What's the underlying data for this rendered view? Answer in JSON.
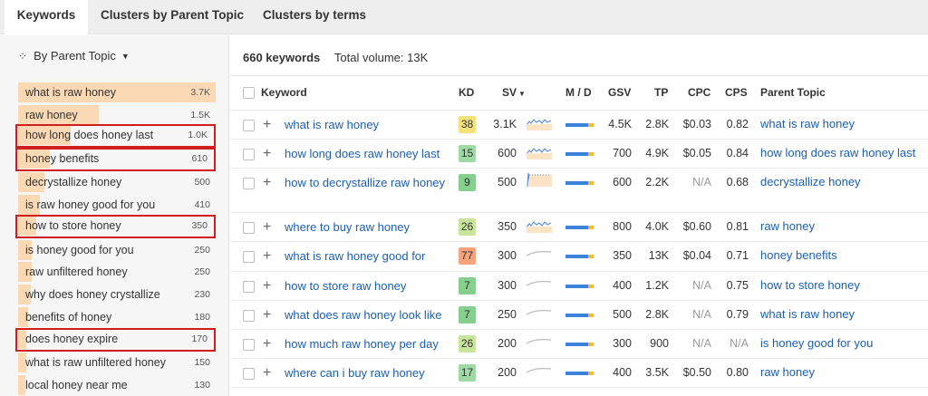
{
  "tabs": [
    "Keywords",
    "Clusters by Parent Topic",
    "Clusters by terms"
  ],
  "sidebar": {
    "group_by": "By Parent Topic",
    "clusters": [
      {
        "name": "what is raw honey",
        "volume": "3.7K",
        "share": 1.0,
        "highlighted": false
      },
      {
        "name": "raw honey",
        "volume": "1.5K",
        "share": 0.41,
        "highlighted": false
      },
      {
        "name": "how long does honey last",
        "volume": "1.0K",
        "share": 0.27,
        "highlighted": true
      },
      {
        "name": "honey benefits",
        "volume": "610",
        "share": 0.165,
        "highlighted": true
      },
      {
        "name": "decrystallize honey",
        "volume": "500",
        "share": 0.135,
        "highlighted": false
      },
      {
        "name": "is raw honey good for you",
        "volume": "410",
        "share": 0.11,
        "highlighted": false
      },
      {
        "name": "how to store honey",
        "volume": "350",
        "share": 0.095,
        "highlighted": true
      },
      {
        "name": "is honey good for you",
        "volume": "250",
        "share": 0.068,
        "highlighted": false
      },
      {
        "name": "raw unfiltered honey",
        "volume": "250",
        "share": 0.068,
        "highlighted": false
      },
      {
        "name": "why does honey crystallize",
        "volume": "230",
        "share": 0.062,
        "highlighted": false
      },
      {
        "name": "benefits of honey",
        "volume": "180",
        "share": 0.049,
        "highlighted": false
      },
      {
        "name": "does honey expire",
        "volume": "170",
        "share": 0.046,
        "highlighted": true
      },
      {
        "name": "what is raw unfiltered honey",
        "volume": "150",
        "share": 0.041,
        "highlighted": false
      },
      {
        "name": "local honey near me",
        "volume": "130",
        "share": 0.035,
        "highlighted": false
      }
    ]
  },
  "summary": {
    "count": "660 keywords",
    "total_volume": "Total volume: 13K"
  },
  "columns": {
    "keyword": "Keyword",
    "kd": "KD",
    "sv": "SV",
    "md": "M / D",
    "gsv": "GSV",
    "tp": "TP",
    "cpc": "CPC",
    "cps": "CPS",
    "parent": "Parent Topic"
  },
  "rows": [
    {
      "keyword": "what is raw honey",
      "kd": "38",
      "kd_color": "#f3e27b",
      "sv": "3.1K",
      "gsv": "4.5K",
      "tp": "2.8K",
      "cpc": "$0.03",
      "cps": "0.82",
      "parent": "what is raw honey",
      "spark": "active"
    },
    {
      "keyword": "how long does raw honey last",
      "kd": "15",
      "kd_color": "#9fd9a4",
      "sv": "600",
      "gsv": "700",
      "tp": "4.9K",
      "cpc": "$0.05",
      "cps": "0.84",
      "parent": "how long does raw honey last",
      "spark": "active"
    },
    {
      "keyword": "how to decrystallize raw honey",
      "kd": "9",
      "kd_color": "#86cf8f",
      "sv": "500",
      "gsv": "600",
      "tp": "2.2K",
      "cpc": "N/A",
      "cps": "0.68",
      "parent": "decrystallize honey",
      "spark": "spike"
    },
    {
      "keyword": "where to buy raw honey",
      "kd": "26",
      "kd_color": "#c8e59b",
      "sv": "350",
      "gsv": "800",
      "tp": "4.0K",
      "cpc": "$0.60",
      "cps": "0.81",
      "parent": "raw honey",
      "spark": "active"
    },
    {
      "keyword": "what is raw honey good for",
      "kd": "77",
      "kd_color": "#f7a37c",
      "sv": "300",
      "gsv": "350",
      "tp": "13K",
      "cpc": "$0.04",
      "cps": "0.71",
      "parent": "honey benefits",
      "spark": "flat"
    },
    {
      "keyword": "how to store raw honey",
      "kd": "7",
      "kd_color": "#86cf8f",
      "sv": "300",
      "gsv": "400",
      "tp": "1.2K",
      "cpc": "N/A",
      "cps": "0.75",
      "parent": "how to store honey",
      "spark": "flat"
    },
    {
      "keyword": "what does raw honey look like",
      "kd": "7",
      "kd_color": "#86cf8f",
      "sv": "250",
      "gsv": "500",
      "tp": "2.8K",
      "cpc": "N/A",
      "cps": "0.79",
      "parent": "what is raw honey",
      "spark": "flat"
    },
    {
      "keyword": "how much raw honey per day",
      "kd": "26",
      "kd_color": "#c8e59b",
      "sv": "200",
      "gsv": "300",
      "tp": "900",
      "cpc": "N/A",
      "cps": "N/A",
      "parent": "is honey good for you",
      "spark": "flat"
    },
    {
      "keyword": "where can i buy raw honey",
      "kd": "17",
      "kd_color": "#9fd9a4",
      "sv": "200",
      "gsv": "400",
      "tp": "3.5K",
      "cpc": "$0.50",
      "cps": "0.80",
      "parent": "raw honey",
      "spark": "flat"
    }
  ],
  "colors": {
    "highlight": "#d01d1d",
    "link": "#1a5fb4",
    "cluster_bar": "#fbd9b4",
    "md_blue": "#3c82d9",
    "md_yellow": "#f4b93b"
  }
}
